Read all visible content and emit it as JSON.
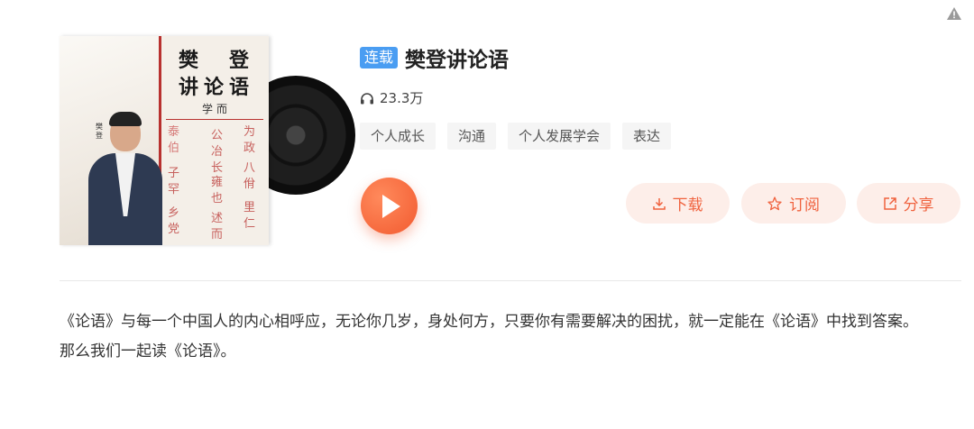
{
  "album": {
    "badge": "连载",
    "title": "樊登讲论语",
    "play_count": "23.3万",
    "tags": [
      "个人成长",
      "沟通",
      "个人发展学会",
      "表达"
    ]
  },
  "cover": {
    "title_line1": "樊　登",
    "title_line2": "讲论语",
    "subtitle": "学而",
    "chapters": [
      "为政",
      "八佾",
      "里仁",
      "公冶长",
      "雍也",
      "述而",
      "泰伯",
      "子罕",
      "乡党"
    ],
    "author": "樊登"
  },
  "actions": {
    "download": "下载",
    "subscribe": "订阅",
    "share": "分享"
  },
  "description": {
    "line1": "《论语》与每一个中国人的内心相呼应，无论你几岁，身处何方，只要你有需要解决的困扰，就一定能在《论语》中找到答案。",
    "line2": "那么我们一起读《论语》。"
  },
  "colors": {
    "accent": "#f25a2f",
    "badge": "#4a9df2",
    "action_bg": "#fdeee9",
    "action_text": "#f0623e"
  },
  "icons": [
    "warning-icon",
    "headphone-icon",
    "play-icon",
    "download-icon",
    "star-icon",
    "share-icon"
  ]
}
